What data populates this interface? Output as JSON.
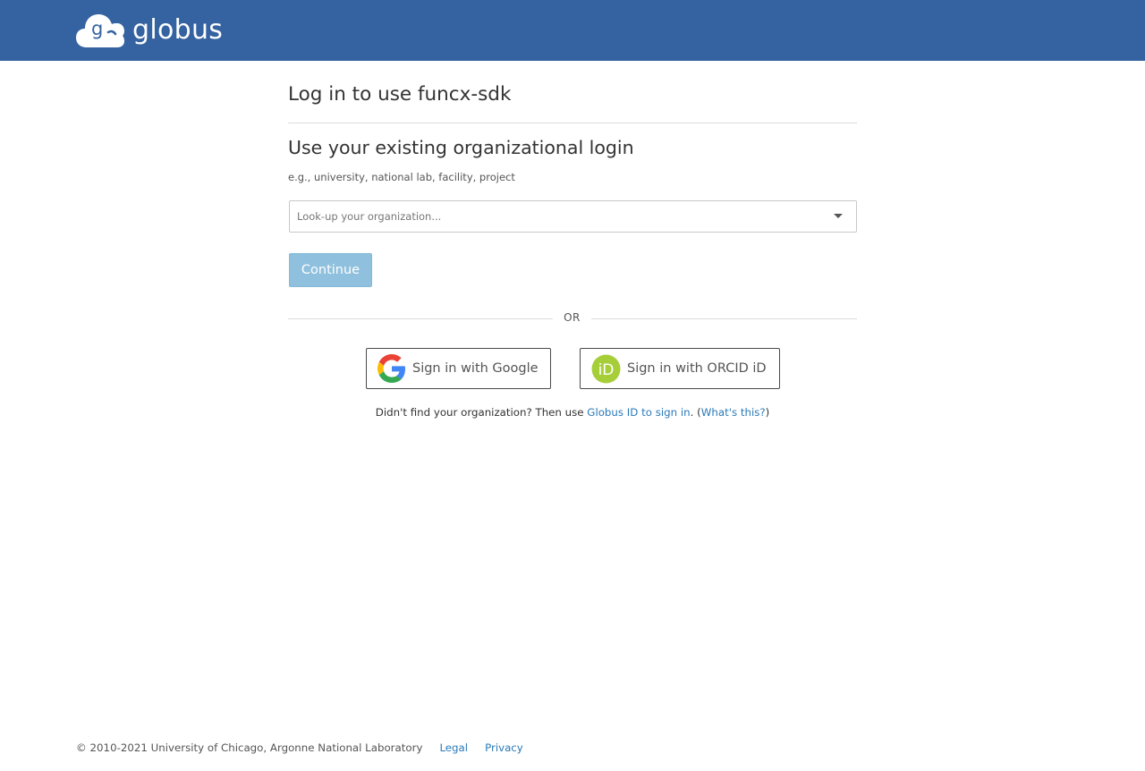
{
  "header": {
    "logo_text": "globus",
    "background_color": "#3563a1"
  },
  "main": {
    "title": "Log in to use funcx-sdk",
    "section_title": "Use your existing organizational login",
    "hint": "e.g., university, national lab, facility, project",
    "org_lookup_placeholder": "Look-up your organization...",
    "continue_label": "Continue",
    "or_label": "OR",
    "google_label": "Sign in with Google",
    "orcid_label": "Sign in with ORCID iD",
    "help_prefix": "Didn't find your organization? Then use ",
    "help_link": "Globus ID to sign in",
    "help_mid": ". (",
    "help_whats_this": "What's this?",
    "help_suffix": ")"
  },
  "footer": {
    "copyright": "© 2010-2021 University of Chicago, Argonne National Laboratory",
    "legal": "Legal",
    "privacy": "Privacy"
  },
  "colors": {
    "link": "#2a7ab8",
    "continue_disabled": "#8fc0dd",
    "orcid_green": "#a6ce39"
  }
}
